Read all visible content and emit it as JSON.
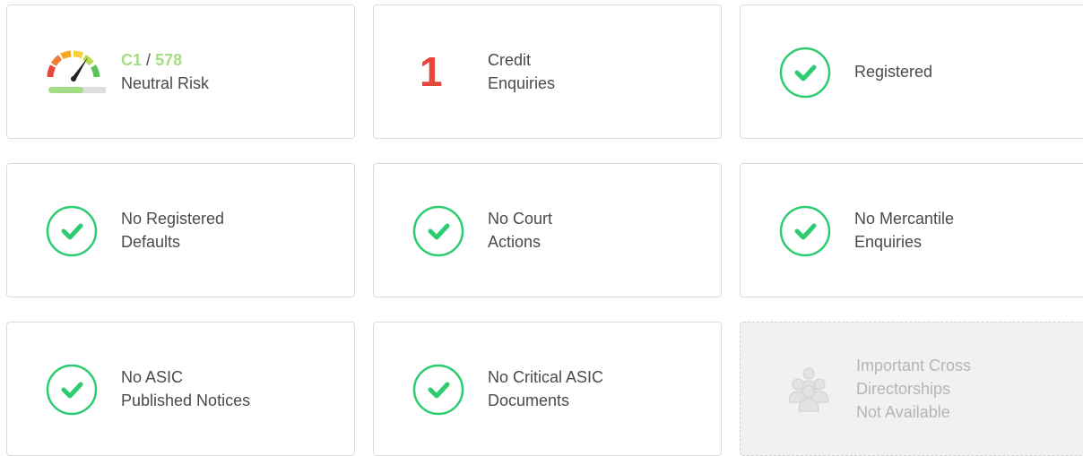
{
  "score": {
    "grade": "C1",
    "separator": "/",
    "value": "578",
    "risk_label": "Neutral Risk",
    "level": 0.55
  },
  "credit_enquiries": {
    "count": "1",
    "line1": "Credit",
    "line2": "Enquiries"
  },
  "registered": {
    "label": "Registered"
  },
  "defaults": {
    "line1": "No Registered",
    "line2": "Defaults"
  },
  "court": {
    "line1": "No Court",
    "line2": "Actions"
  },
  "mercantile": {
    "line1": "No Mercantile",
    "line2": "Enquiries"
  },
  "asic_notices": {
    "line1": "No ASIC",
    "line2": "Published Notices"
  },
  "asic_documents": {
    "line1": "No Critical ASIC",
    "line2": "Documents"
  },
  "directorships": {
    "line1": "Important Cross",
    "line2": "Directorships",
    "line3": "Not Available"
  },
  "colors": {
    "check_green": "#2ecc71",
    "score_green": "#a5dc86",
    "count_red": "#e8453c",
    "disabled_grey": "#b5b5b5"
  },
  "icons": {
    "check": "check-circle-icon",
    "gauge": "risk-gauge-icon",
    "people": "people-group-icon"
  }
}
